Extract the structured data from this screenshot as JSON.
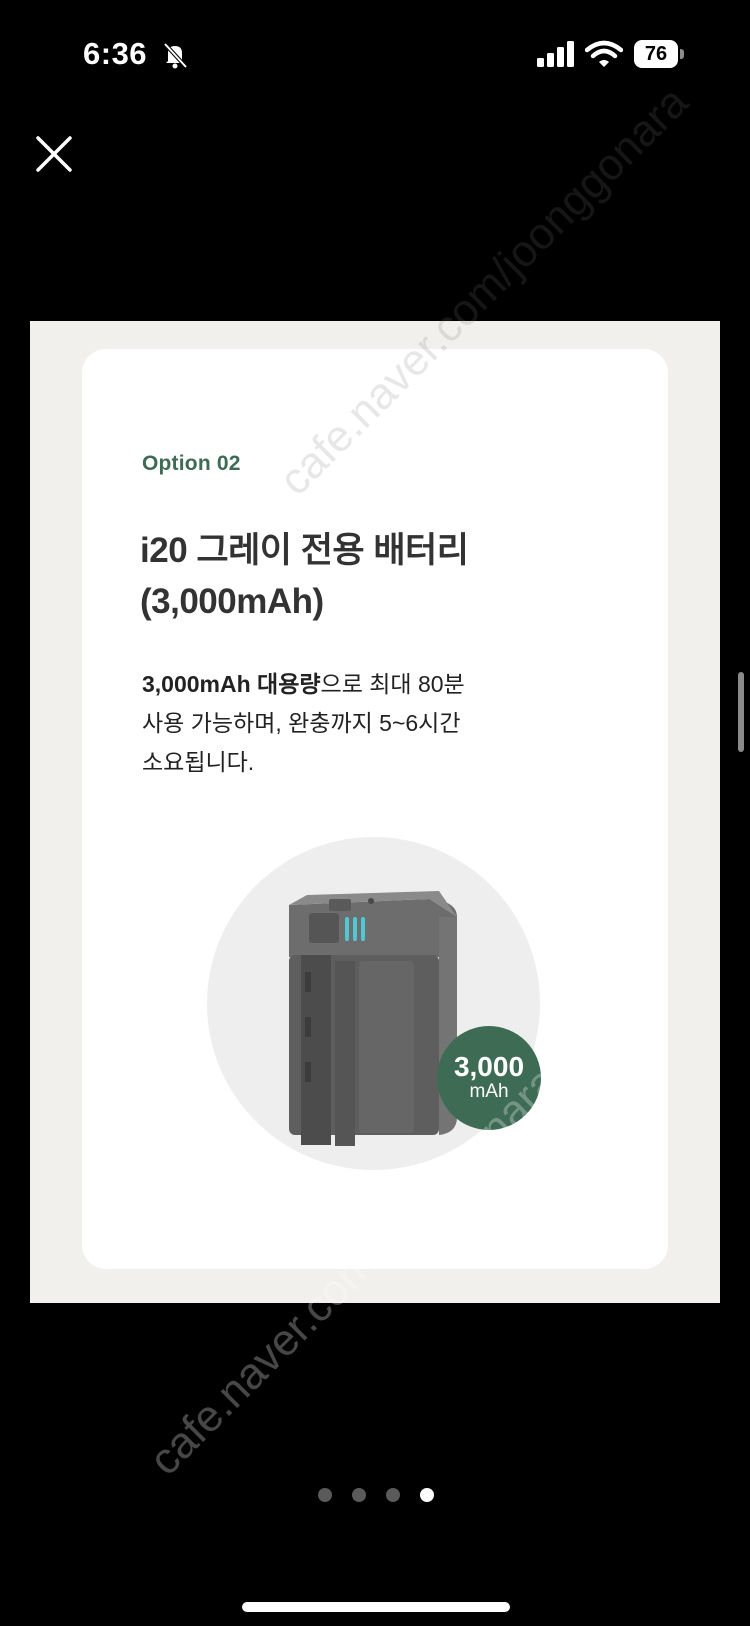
{
  "status_bar": {
    "time": "6:36",
    "battery_level": "76"
  },
  "card": {
    "option_label": "Option 02",
    "title_line1": "i20 그레이 전용 배터리",
    "title_line2": "(3,000mAh)",
    "desc_bold": "3,000mAh 대용량",
    "desc_rest1": "으로 최대 80분",
    "desc_line2": "사용 가능하며, 완충까지 5~6시간",
    "desc_line3": "소요됩니다.",
    "badge_value": "3,000",
    "badge_unit": "mAh"
  },
  "pager": {
    "total": 4,
    "active_index": 3
  },
  "watermarks": [
    "cafe.naver.com/joonggonara",
    "cafe.naver.com/joonggonara"
  ],
  "colors": {
    "accent_green": "#3d6b53",
    "panel_bg": "#f1f0ed"
  }
}
